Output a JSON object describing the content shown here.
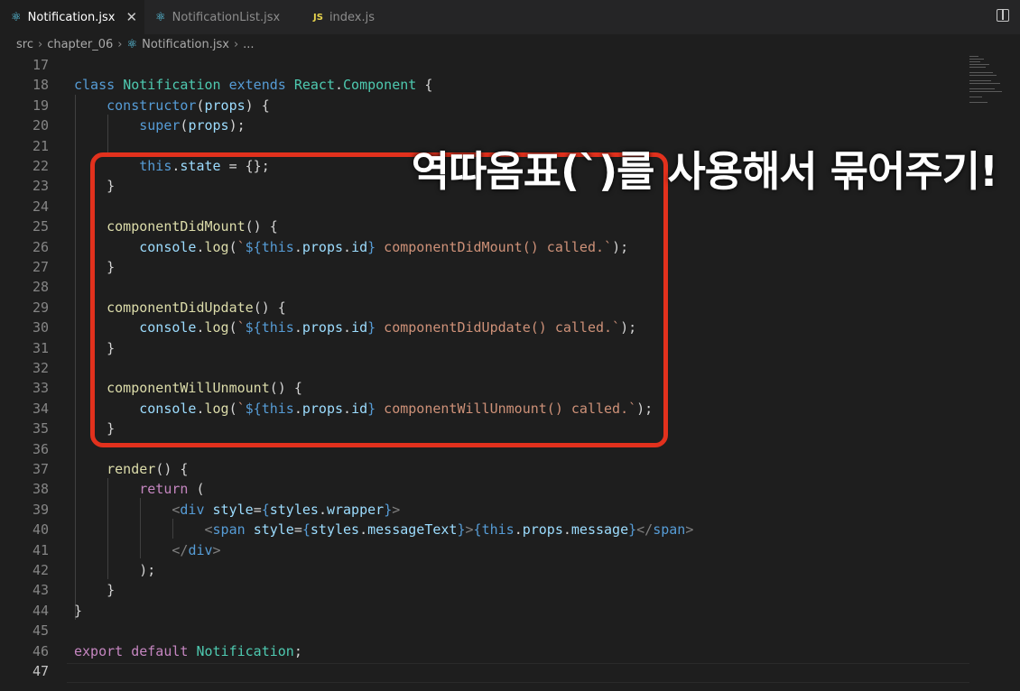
{
  "tabs": [
    {
      "label": "Notification.jsx",
      "icon": "react-icon",
      "active": true
    },
    {
      "label": "NotificationList.jsx",
      "icon": "react-icon",
      "active": false
    },
    {
      "label": "index.js",
      "icon": "js-icon",
      "active": false
    }
  ],
  "breadcrumb": [
    "src",
    "chapter_06",
    "Notification.jsx",
    "..."
  ],
  "caption": "역따옴표(`)를 사용해서 묶어주기!",
  "lines": [
    {
      "n": "17",
      "c": []
    },
    {
      "n": "18",
      "c": [
        [
          "kw",
          "class "
        ],
        [
          "ty",
          "Notification "
        ],
        [
          "kw",
          "extends "
        ],
        [
          "ty",
          "React"
        ],
        [
          "",
          "."
        ],
        [
          "ty",
          "Component"
        ],
        [
          "",
          " {"
        ]
      ]
    },
    {
      "n": "19",
      "c": [
        [
          "",
          "    "
        ],
        [
          "kw",
          "constructor"
        ],
        [
          "",
          "("
        ],
        [
          "var",
          "props"
        ],
        [
          "",
          ") {"
        ]
      ]
    },
    {
      "n": "20",
      "c": [
        [
          "",
          "        "
        ],
        [
          "kw",
          "super"
        ],
        [
          "",
          "("
        ],
        [
          "var",
          "props"
        ],
        [
          "",
          ");"
        ]
      ]
    },
    {
      "n": "21",
      "c": []
    },
    {
      "n": "22",
      "c": [
        [
          "",
          "        "
        ],
        [
          "kw",
          "this"
        ],
        [
          "",
          "."
        ],
        [
          "var",
          "state"
        ],
        [
          "",
          " = {};"
        ]
      ]
    },
    {
      "n": "23",
      "c": [
        [
          "",
          "    }"
        ]
      ]
    },
    {
      "n": "24",
      "c": []
    },
    {
      "n": "25",
      "c": [
        [
          "",
          "    "
        ],
        [
          "fn",
          "componentDidMount"
        ],
        [
          "",
          "() {"
        ]
      ]
    },
    {
      "n": "26",
      "c": [
        [
          "",
          "        "
        ],
        [
          "var",
          "console"
        ],
        [
          "",
          "."
        ],
        [
          "fn",
          "log"
        ],
        [
          "",
          "("
        ],
        [
          "str",
          "`"
        ],
        [
          "br",
          "${"
        ],
        [
          "kw",
          "this"
        ],
        [
          "",
          "."
        ],
        [
          "var",
          "props"
        ],
        [
          "",
          "."
        ],
        [
          "var",
          "id"
        ],
        [
          "br",
          "}"
        ],
        [
          "str",
          " componentDidMount() called.`"
        ],
        [
          "",
          ");"
        ]
      ]
    },
    {
      "n": "27",
      "c": [
        [
          "",
          "    }"
        ]
      ]
    },
    {
      "n": "28",
      "c": []
    },
    {
      "n": "29",
      "c": [
        [
          "",
          "    "
        ],
        [
          "fn",
          "componentDidUpdate"
        ],
        [
          "",
          "() {"
        ]
      ]
    },
    {
      "n": "30",
      "c": [
        [
          "",
          "        "
        ],
        [
          "var",
          "console"
        ],
        [
          "",
          "."
        ],
        [
          "fn",
          "log"
        ],
        [
          "",
          "("
        ],
        [
          "str",
          "`"
        ],
        [
          "br",
          "${"
        ],
        [
          "kw",
          "this"
        ],
        [
          "",
          "."
        ],
        [
          "var",
          "props"
        ],
        [
          "",
          "."
        ],
        [
          "var",
          "id"
        ],
        [
          "br",
          "}"
        ],
        [
          "str",
          " componentDidUpdate() called.`"
        ],
        [
          "",
          ");"
        ]
      ]
    },
    {
      "n": "31",
      "c": [
        [
          "",
          "    }"
        ]
      ]
    },
    {
      "n": "32",
      "c": []
    },
    {
      "n": "33",
      "c": [
        [
          "",
          "    "
        ],
        [
          "fn",
          "componentWillUnmount"
        ],
        [
          "",
          "() {"
        ]
      ]
    },
    {
      "n": "34",
      "c": [
        [
          "",
          "        "
        ],
        [
          "var",
          "console"
        ],
        [
          "",
          "."
        ],
        [
          "fn",
          "log"
        ],
        [
          "",
          "("
        ],
        [
          "str",
          "`"
        ],
        [
          "br",
          "${"
        ],
        [
          "kw",
          "this"
        ],
        [
          "",
          "."
        ],
        [
          "var",
          "props"
        ],
        [
          "",
          "."
        ],
        [
          "var",
          "id"
        ],
        [
          "br",
          "}"
        ],
        [
          "str",
          " componentWillUnmount() called.`"
        ],
        [
          "",
          ");"
        ]
      ]
    },
    {
      "n": "35",
      "c": [
        [
          "",
          "    }"
        ]
      ]
    },
    {
      "n": "36",
      "c": []
    },
    {
      "n": "37",
      "c": [
        [
          "",
          "    "
        ],
        [
          "fn",
          "render"
        ],
        [
          "",
          "() {"
        ]
      ]
    },
    {
      "n": "38",
      "c": [
        [
          "",
          "        "
        ],
        [
          "pink",
          "return"
        ],
        [
          "",
          " ("
        ]
      ]
    },
    {
      "n": "39",
      "c": [
        [
          "",
          "            "
        ],
        [
          "tag",
          "<"
        ],
        [
          "tn",
          "div "
        ],
        [
          "at",
          "style"
        ],
        [
          "",
          "="
        ],
        [
          "br",
          "{"
        ],
        [
          "var",
          "styles"
        ],
        [
          "",
          "."
        ],
        [
          "var",
          "wrapper"
        ],
        [
          "br",
          "}"
        ],
        [
          "tag",
          ">"
        ]
      ]
    },
    {
      "n": "40",
      "c": [
        [
          "",
          "                "
        ],
        [
          "tag",
          "<"
        ],
        [
          "tn",
          "span "
        ],
        [
          "at",
          "style"
        ],
        [
          "",
          "="
        ],
        [
          "br",
          "{"
        ],
        [
          "var",
          "styles"
        ],
        [
          "",
          "."
        ],
        [
          "var",
          "messageText"
        ],
        [
          "br",
          "}"
        ],
        [
          "tag",
          ">"
        ],
        [
          "br",
          "{"
        ],
        [
          "kw",
          "this"
        ],
        [
          "",
          "."
        ],
        [
          "var",
          "props"
        ],
        [
          "",
          "."
        ],
        [
          "var",
          "message"
        ],
        [
          "br",
          "}"
        ],
        [
          "tag",
          "</"
        ],
        [
          "tn",
          "span"
        ],
        [
          "tag",
          ">"
        ]
      ]
    },
    {
      "n": "41",
      "c": [
        [
          "",
          "            "
        ],
        [
          "tag",
          "</"
        ],
        [
          "tn",
          "div"
        ],
        [
          "tag",
          ">"
        ]
      ]
    },
    {
      "n": "42",
      "c": [
        [
          "",
          "        );"
        ]
      ]
    },
    {
      "n": "43",
      "c": [
        [
          "",
          "    }"
        ]
      ]
    },
    {
      "n": "44",
      "c": [
        [
          "",
          "}"
        ]
      ]
    },
    {
      "n": "45",
      "c": []
    },
    {
      "n": "46",
      "c": [
        [
          "pink",
          "export "
        ],
        [
          "pink",
          "default "
        ],
        [
          "ty",
          "Notification"
        ],
        [
          "",
          ";"
        ]
      ]
    },
    {
      "n": "47",
      "c": []
    }
  ],
  "current_line": "47"
}
